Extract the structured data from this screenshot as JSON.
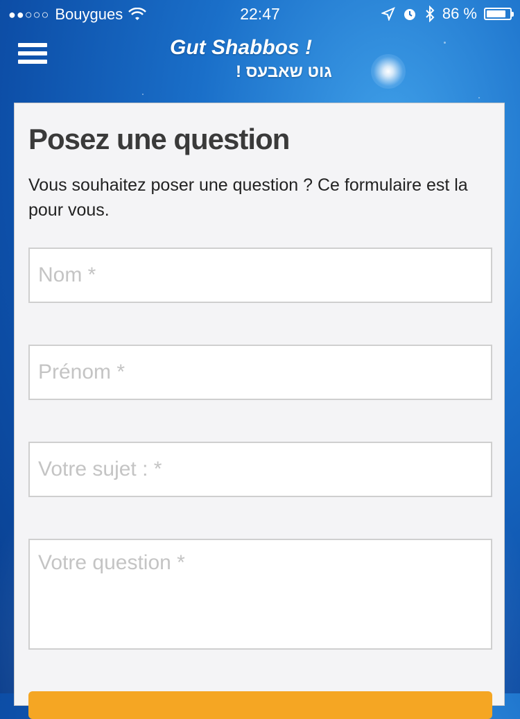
{
  "status_bar": {
    "signal": "●●○○○",
    "carrier": "Bouygues",
    "time": "22:47",
    "battery": "86 %",
    "battery_level": 0.86
  },
  "header": {
    "menu_icon": "hamburger-icon",
    "logo_line1": "Gut Shabbos !",
    "logo_line2": "גוט שאבעס !"
  },
  "form": {
    "title": "Posez une question",
    "intro": "Vous souhaitez poser une question ? Ce formulaire est la pour vous.",
    "fields": {
      "nom_placeholder": "Nom *",
      "prenom_placeholder": "Prénom *",
      "sujet_placeholder": "Votre sujet : *",
      "question_placeholder": "Votre question *"
    },
    "submit_color": "#f5a623"
  },
  "colors": {
    "accent": "#f5a623",
    "background": "#1a6fc9"
  }
}
